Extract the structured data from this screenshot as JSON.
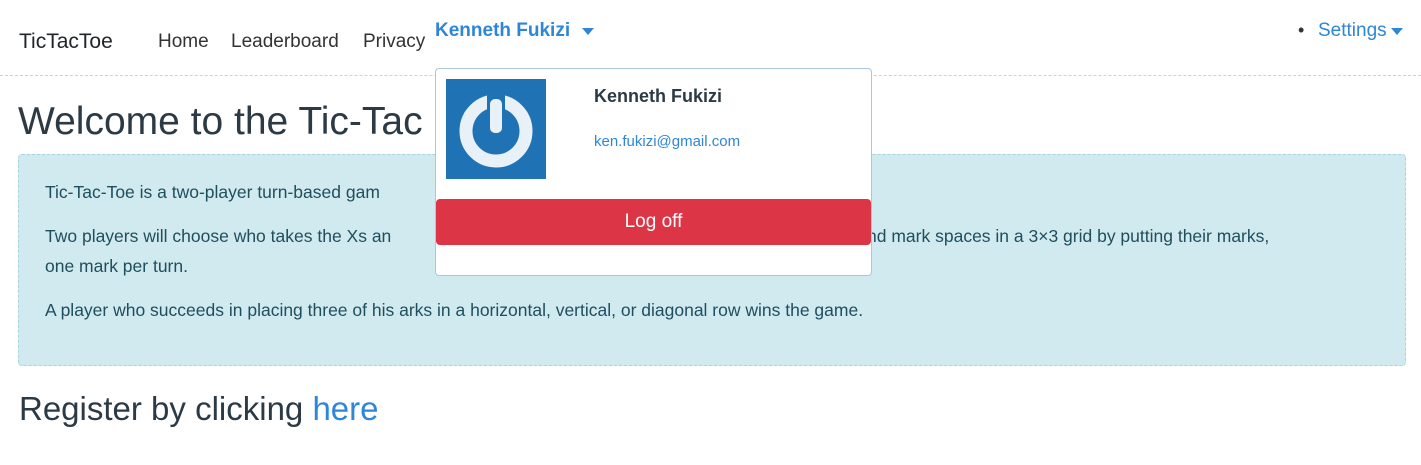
{
  "navbar": {
    "brand": "TicTacToe",
    "links": [
      "Home",
      "Leaderboard",
      "Privacy"
    ],
    "user_toggle": "Kenneth Fukizi",
    "settings_bullet": "•",
    "settings": "Settings"
  },
  "main": {
    "heading": "Welcome to the Tic-Tac",
    "paragraphs": [
      "Tic-Tac-Toe is a two-player turn-based gam",
      "Two players will choose who takes the Xs an",
      "and mark spaces in a 3×3 grid by putting their marks,",
      "one mark per turn.",
      "A player who succeeds in placing three of his arks in a horizontal, vertical, or diagonal row wins the game."
    ],
    "register_text": "Register by clicking",
    "register_link": "here"
  },
  "dropdown": {
    "name": "Kenneth Fukizi",
    "email": "ken.fukizi@gmail.com",
    "logoff": "Log off",
    "avatar_icon": "power-icon"
  },
  "colors": {
    "link": "#2e86d9",
    "info_bg": "#d0eaef",
    "danger": "#dc3545",
    "avatar_bg": "#1f72b4"
  }
}
